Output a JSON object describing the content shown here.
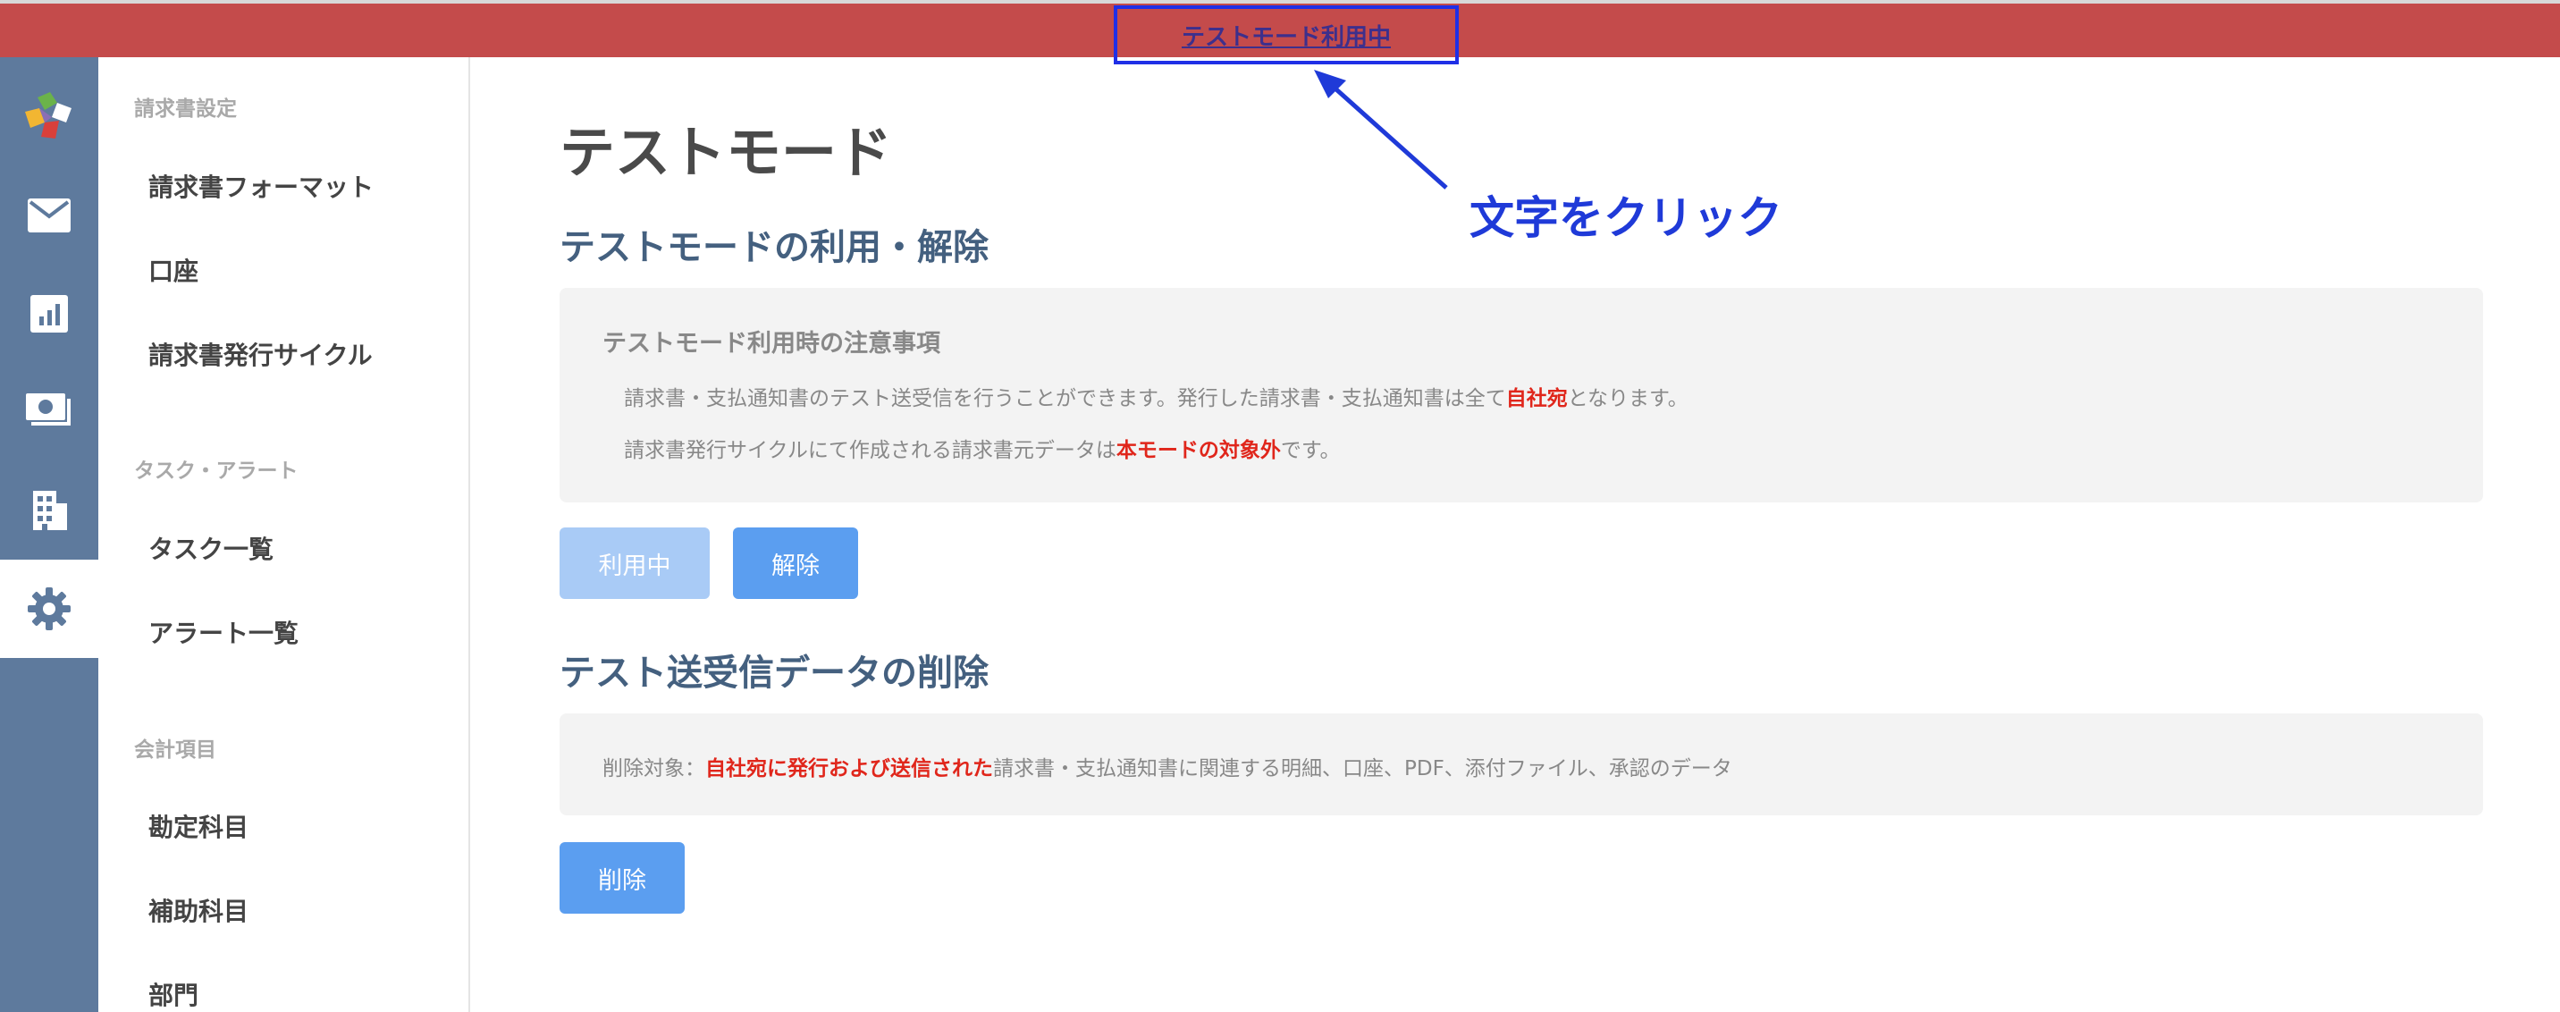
{
  "banner": {
    "link_text": "テストモード利用中"
  },
  "rail": {
    "items": [
      {
        "icon": "puzzle-logo-icon"
      },
      {
        "icon": "mail-icon"
      },
      {
        "icon": "bar-chart-icon"
      },
      {
        "icon": "payment-icon"
      },
      {
        "icon": "building-icon"
      },
      {
        "icon": "gear-icon",
        "active": true
      }
    ]
  },
  "sidebar": {
    "groups": [
      {
        "title": "請求書設定",
        "items": [
          "請求書フォーマット",
          "口座",
          "請求書発行サイクル"
        ]
      },
      {
        "title": "タスク・アラート",
        "items": [
          "タスク一覧",
          "アラート一覧"
        ]
      },
      {
        "title": "会計項目",
        "items": [
          "勘定科目",
          "補助科目",
          "部門"
        ]
      }
    ]
  },
  "main": {
    "title": "テストモード",
    "section1": {
      "title": "テストモードの利用・解除",
      "note_title": "テストモード利用時の注意事項",
      "line1_pre": "請求書・支払通知書のテスト送受信を行うことができます。発行した請求書・支払通知書は全て",
      "line1_red": "自社宛",
      "line1_post": "となります。",
      "line2_pre": "請求書発行サイクルにて作成される請求書元データは",
      "line2_red": "本モードの対象外",
      "line2_post": "です。",
      "btn_in_use": "利用中",
      "btn_release": "解除"
    },
    "section2": {
      "title": "テスト送受信データの削除",
      "line_pre": "削除対象：",
      "line_red": "自社宛に発行および送信された",
      "line_post": "請求書・支払通知書に関連する明細、口座、PDF、添付ファイル、承認のデータ",
      "btn_delete": "削除"
    }
  },
  "annotation": {
    "text": "文字をクリック"
  },
  "colors": {
    "banner": "#c44b4b",
    "rail": "#5e7a9d",
    "primary_button": "#5b9ef0",
    "disabled_button": "#a9cbf6",
    "highlight_red": "#e0261b",
    "annotation_blue": "#1f3ad8"
  }
}
